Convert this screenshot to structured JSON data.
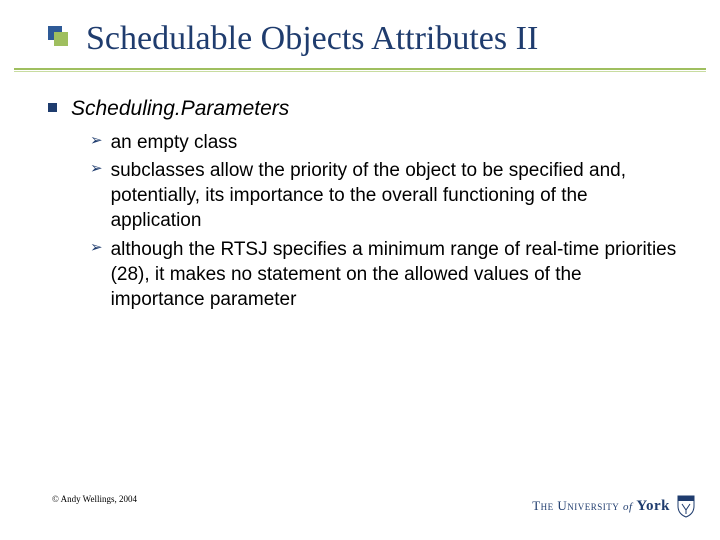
{
  "title": "Schedulable Objects Attributes II",
  "heading": "Scheduling.Parameters",
  "bullets": [
    "an empty class",
    "subclasses allow the priority of the object to be specified and, potentially, its importance to the overall functioning of the application",
    "although the RTSJ specifies a minimum range of real-time priorities (28), it makes no statement on the allowed values of the importance parameter"
  ],
  "copyright": "© Andy Wellings, 2004",
  "logo": {
    "prefix": "The University",
    "of": "of",
    "name": "York"
  }
}
